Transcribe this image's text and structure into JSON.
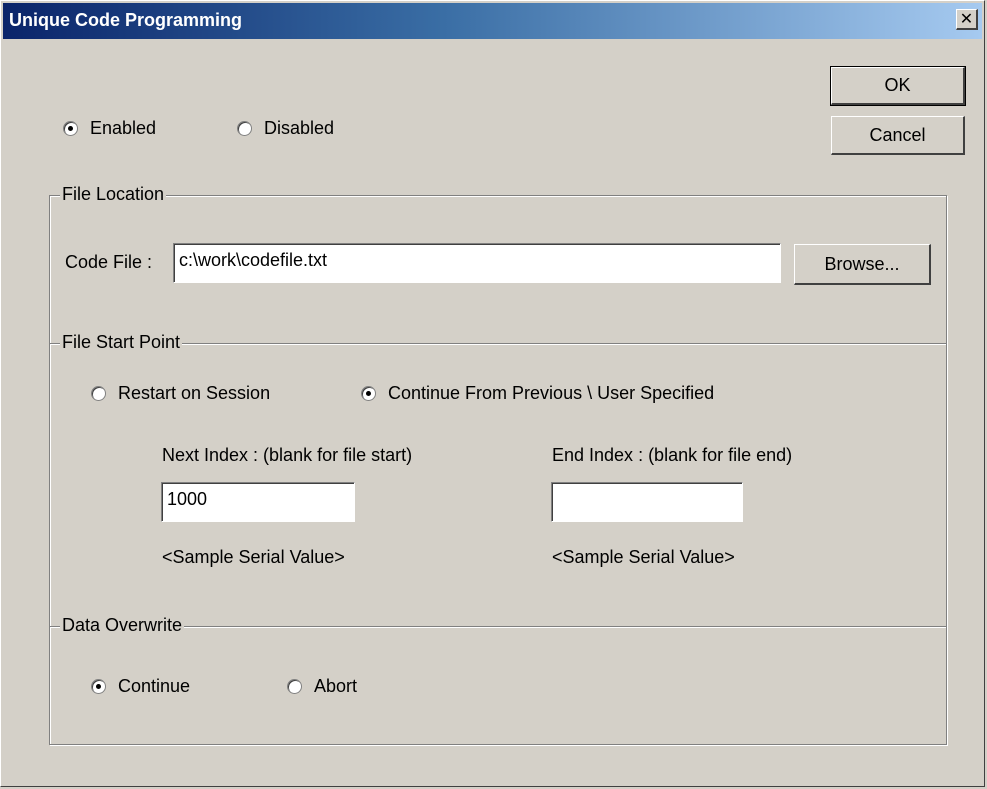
{
  "window": {
    "title": "Unique Code Programming",
    "close_glyph": "✕"
  },
  "buttons": {
    "ok": "OK",
    "cancel": "Cancel",
    "browse": "Browse..."
  },
  "enable_options": {
    "enabled": "Enabled",
    "disabled": "Disabled",
    "selected": "enabled"
  },
  "file_location": {
    "legend": "File Location",
    "code_file_label": "Code File :",
    "code_file_value": "c:\\work\\codefile.txt"
  },
  "file_start_point": {
    "legend": "File Start Point",
    "restart_label": "Restart on Session",
    "continue_label": "Continue From Previous \\ User Specified",
    "selected": "continue",
    "next_index_label": "Next Index : (blank for file start)",
    "next_index_value": "1000",
    "end_index_label": "End Index : (blank for file end)",
    "end_index_value": "",
    "sample_next": "<Sample Serial Value>",
    "sample_end": "<Sample Serial Value>"
  },
  "data_overwrite": {
    "legend": "Data Overwrite",
    "continue_label": "Continue",
    "abort_label": "Abort",
    "selected": "continue"
  }
}
